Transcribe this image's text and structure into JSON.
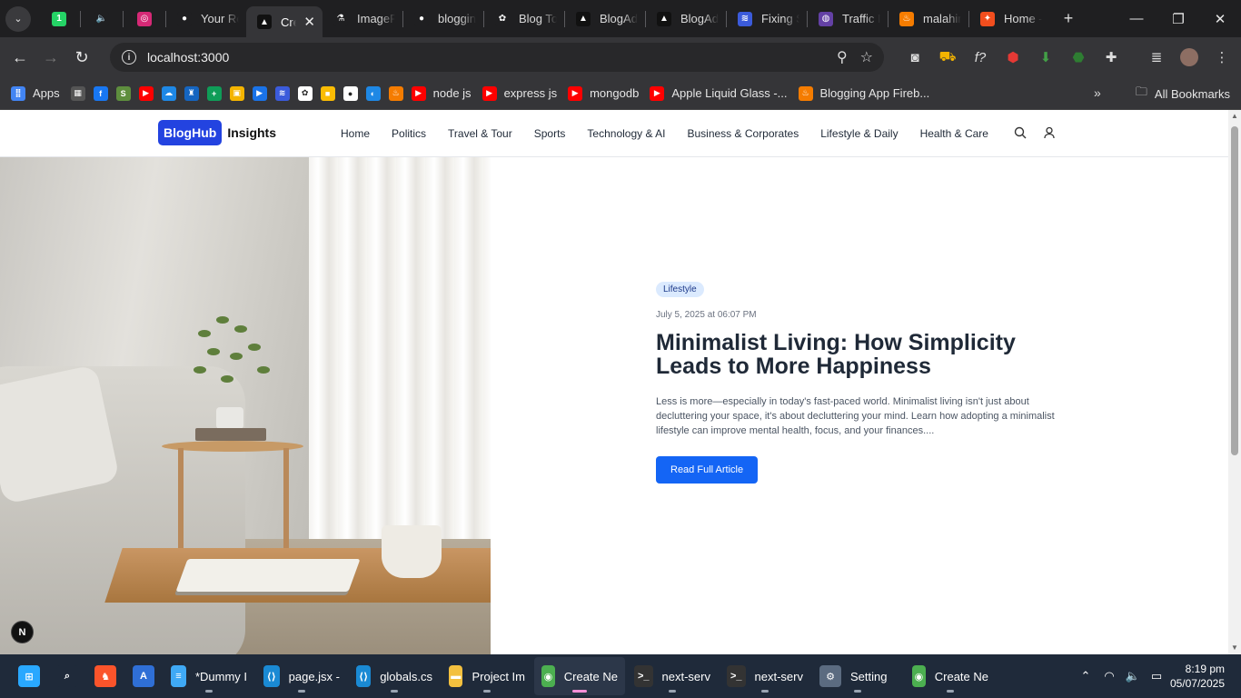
{
  "browser": {
    "tabs": [
      {
        "title": "",
        "pinned": true,
        "icon": "whatsapp-icon",
        "color": "#25d366",
        "glyph": "1"
      },
      {
        "title": "",
        "pinned": true,
        "icon": "speaker-icon",
        "color": "#1f1f21",
        "glyph": "🔈"
      },
      {
        "title": "",
        "pinned": true,
        "icon": "instagram-icon",
        "color": "#d62976",
        "glyph": "◎"
      },
      {
        "title": "Your Re",
        "icon": "github-icon",
        "color": "#1f1f21",
        "glyph": "●"
      },
      {
        "title": "Cre",
        "active": true,
        "icon": "vercel-icon",
        "color": "#111111",
        "glyph": "▲"
      },
      {
        "title": "ImageF",
        "icon": "flask-icon",
        "color": "#1f1f21",
        "glyph": "⚗"
      },
      {
        "title": "bloggin",
        "icon": "github-icon",
        "color": "#1f1f21",
        "glyph": "●"
      },
      {
        "title": "Blog To",
        "icon": "openai-icon",
        "color": "#1f1f21",
        "glyph": "✿"
      },
      {
        "title": "BlogAd",
        "icon": "vercel-icon",
        "color": "#111111",
        "glyph": "▲"
      },
      {
        "title": "BlogAd",
        "icon": "vercel-icon",
        "color": "#111111",
        "glyph": "▲"
      },
      {
        "title": "Fixing S",
        "icon": "windsurf-icon",
        "color": "#3b5bdb",
        "glyph": "≋"
      },
      {
        "title": "Traffic R",
        "icon": "twitch-icon",
        "color": "#6441a5",
        "glyph": "◍"
      },
      {
        "title": "malahin",
        "icon": "firebase-icon",
        "color": "#f57c00",
        "glyph": "♨"
      },
      {
        "title": "Home -",
        "icon": "figma-icon",
        "color": "#f24e1e",
        "glyph": "✦"
      }
    ],
    "url": "localhost:3000",
    "bookmarks": [
      {
        "label": "Apps",
        "icon": "apps-grid-icon",
        "color": "#4285f4",
        "glyph": "⣿"
      },
      {
        "label": "",
        "icon": "grid-icon",
        "color": "#555555",
        "glyph": "▦"
      },
      {
        "label": "",
        "icon": "facebook-icon",
        "color": "#1877f2",
        "glyph": "f"
      },
      {
        "label": "",
        "icon": "shopify-icon",
        "color": "#5e8e3e",
        "glyph": "S"
      },
      {
        "label": "",
        "icon": "youtube-icon",
        "color": "#ff0000",
        "glyph": "▶"
      },
      {
        "label": "",
        "icon": "cloud-icon",
        "color": "#1e88e5",
        "glyph": "☁"
      },
      {
        "label": "",
        "icon": "graduation-icon",
        "color": "#1565c0",
        "glyph": "♜"
      },
      {
        "label": "",
        "icon": "sheets-icon",
        "color": "#0f9d58",
        "glyph": "+"
      },
      {
        "label": "",
        "icon": "photos-icon",
        "color": "#f4b400",
        "glyph": "▣"
      },
      {
        "label": "",
        "icon": "video-icon",
        "color": "#1a73e8",
        "glyph": "▶"
      },
      {
        "label": "",
        "icon": "windsurf-icon",
        "color": "#3b5bdb",
        "glyph": "≋"
      },
      {
        "label": "",
        "icon": "openai-icon",
        "color": "#ffffff",
        "glyph": "✿"
      },
      {
        "label": "",
        "icon": "keep-icon",
        "color": "#fbbc04",
        "glyph": "■"
      },
      {
        "label": "",
        "icon": "github-icon",
        "color": "#ffffff",
        "glyph": "●"
      },
      {
        "label": "",
        "icon": "edge-icon",
        "color": "#1e88e5",
        "glyph": "◐"
      },
      {
        "label": "",
        "icon": "firebase-icon",
        "color": "#f57c00",
        "glyph": "♨"
      },
      {
        "label": "node js",
        "icon": "youtube-icon",
        "color": "#ff0000",
        "glyph": "▶"
      },
      {
        "label": "express js",
        "icon": "youtube-icon",
        "color": "#ff0000",
        "glyph": "▶"
      },
      {
        "label": "mongodb",
        "icon": "youtube-icon",
        "color": "#ff0000",
        "glyph": "▶"
      },
      {
        "label": "Apple Liquid Glass -...",
        "icon": "youtube-icon",
        "color": "#ff0000",
        "glyph": "▶"
      },
      {
        "label": "Blogging App Fireb...",
        "icon": "firebase-icon",
        "color": "#f57c00",
        "glyph": "♨"
      }
    ],
    "all_bookmarks": "All Bookmarks"
  },
  "site": {
    "logo_box": "BlogHub",
    "logo_text": "Insights",
    "nav": [
      "Home",
      "Politics",
      "Travel & Tour",
      "Sports",
      "Technology & AI",
      "Business & Corporates",
      "Lifestyle & Daily",
      "Health & Care"
    ]
  },
  "hero": {
    "category": "Lifestyle",
    "date": "July 5, 2025 at 06:07 PM",
    "title": "Minimalist Living: How Simplicity Leads to More Happiness",
    "excerpt": "Less is more—especially in today's fast-paced world. Minimalist living isn't just about decluttering your space, it's about decluttering your mind. Learn how adopting a minimalist lifestyle can improve mental health, focus, and your finances....",
    "cta": "Read Full Article",
    "dev_badge": "N"
  },
  "taskbar": {
    "items": [
      {
        "label": "",
        "icon": "windows-start-icon",
        "color": "#29a8ff",
        "glyph": "⊞"
      },
      {
        "label": "",
        "icon": "search-icon",
        "color": "#1f2a3a",
        "glyph": "⌕"
      },
      {
        "label": "",
        "icon": "brave-icon",
        "color": "#fb542b",
        "glyph": "♞"
      },
      {
        "label": "",
        "icon": "azure-icon",
        "color": "#2f6fd6",
        "glyph": "A"
      },
      {
        "label": "*Dummy I",
        "icon": "notepad-icon",
        "color": "#3fa9f5",
        "glyph": "≡"
      },
      {
        "label": "page.jsx -",
        "icon": "vscode-icon",
        "color": "#1a8ad4",
        "glyph": "⟨⟩"
      },
      {
        "label": "globals.cs",
        "icon": "vscode-icon",
        "color": "#1a8ad4",
        "glyph": "⟨⟩"
      },
      {
        "label": "Project Im",
        "icon": "folder-icon",
        "color": "#f3c03f",
        "glyph": "▬"
      },
      {
        "label": "Create Ne",
        "icon": "chrome-icon",
        "color": "#4caf50",
        "glyph": "◉",
        "active": true
      },
      {
        "label": "next-serv",
        "icon": "terminal-icon",
        "color": "#333333",
        "glyph": ">_"
      },
      {
        "label": "next-serv",
        "icon": "terminal-icon",
        "color": "#333333",
        "glyph": ">_"
      },
      {
        "label": "Setting",
        "icon": "settings-gear-icon",
        "color": "#5b6b80",
        "glyph": "⚙"
      },
      {
        "label": "Create Ne",
        "icon": "chrome-icon",
        "color": "#4caf50",
        "glyph": "◉"
      }
    ],
    "time": "8:19 pm",
    "date": "05/07/2025"
  }
}
